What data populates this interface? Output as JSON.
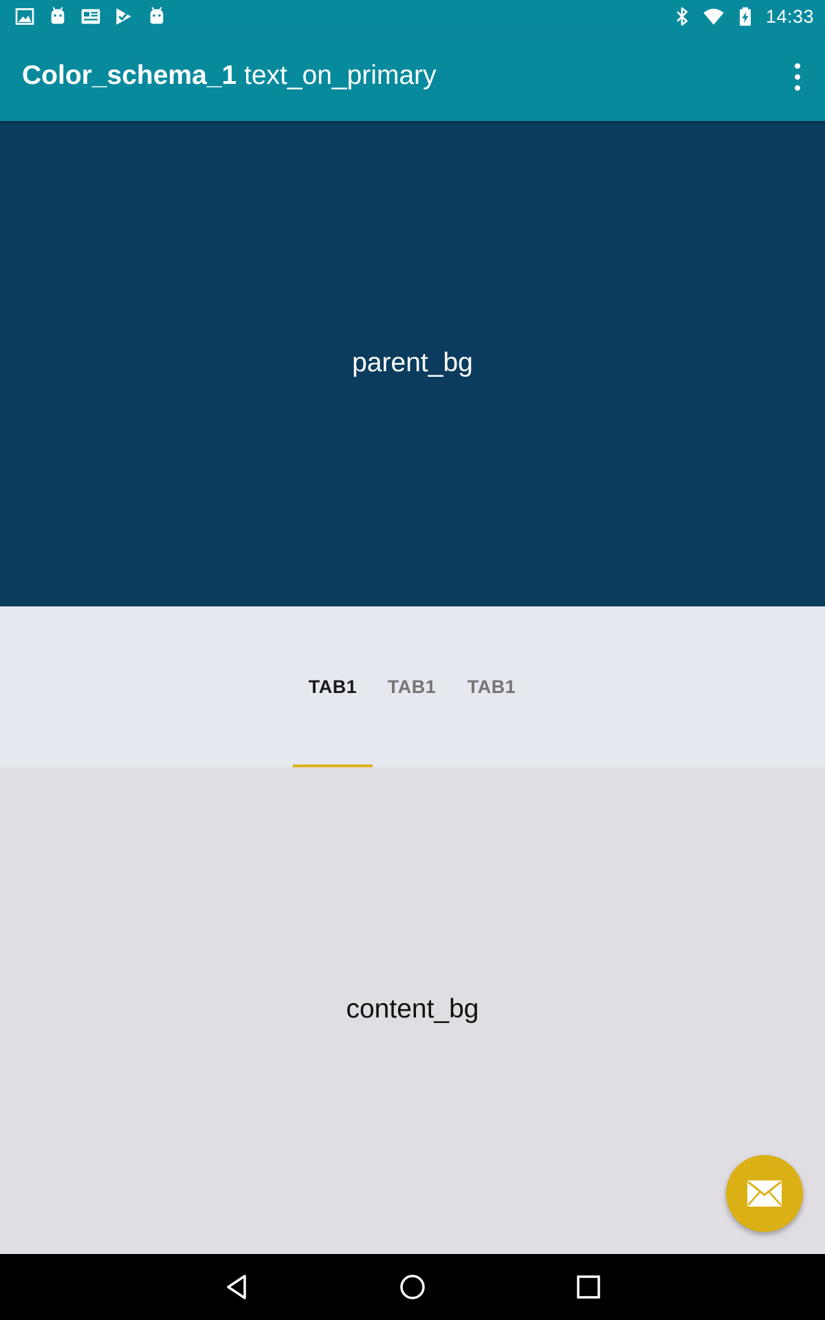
{
  "status_bar": {
    "time": "14:33",
    "left_icons": [
      "image-icon",
      "android-icon",
      "news-icon",
      "play-store-icon",
      "android-icon"
    ],
    "right_icons": [
      "bluetooth-icon",
      "wifi-icon",
      "battery-charging-icon"
    ]
  },
  "app_bar": {
    "title_bold": "Color_schema_1",
    "title_rest": "text_on_primary",
    "overflow_icon": "more-vert-icon"
  },
  "parent": {
    "label": "parent_bg"
  },
  "tabs": [
    {
      "label": "TAB1",
      "selected": true
    },
    {
      "label": "TAB1",
      "selected": false
    },
    {
      "label": "TAB1",
      "selected": false
    }
  ],
  "content": {
    "label": "content_bg"
  },
  "fab": {
    "icon": "mail-icon"
  },
  "nav_bar": {
    "icons": [
      "back-icon",
      "home-icon",
      "recents-icon"
    ]
  },
  "colors": {
    "primary": "#088a9d",
    "parent_bg": "#0b3c5d",
    "tab_bg": "#e6e8ef",
    "content_bg": "#e0dde3",
    "accent": "#dbb015"
  }
}
